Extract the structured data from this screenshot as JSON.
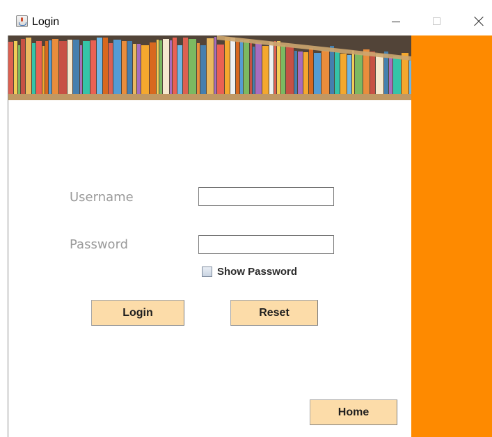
{
  "window": {
    "title": "Login",
    "icon": "java-cup-icon",
    "controls": [
      "minimize-icon",
      "maximize-icon",
      "close-icon"
    ]
  },
  "banner": {
    "image": "bookshelf"
  },
  "form": {
    "username_label": "Username",
    "username_value": "",
    "password_label": "Password",
    "password_value": "",
    "show_password_label": "Show Password",
    "show_password_checked": false
  },
  "buttons": {
    "login": "Login",
    "reset": "Reset",
    "home": "Home"
  },
  "colors": {
    "side_panel": "#fe8a00",
    "button_bg": "#fcdca9",
    "label_text": "#9a9a9a"
  }
}
